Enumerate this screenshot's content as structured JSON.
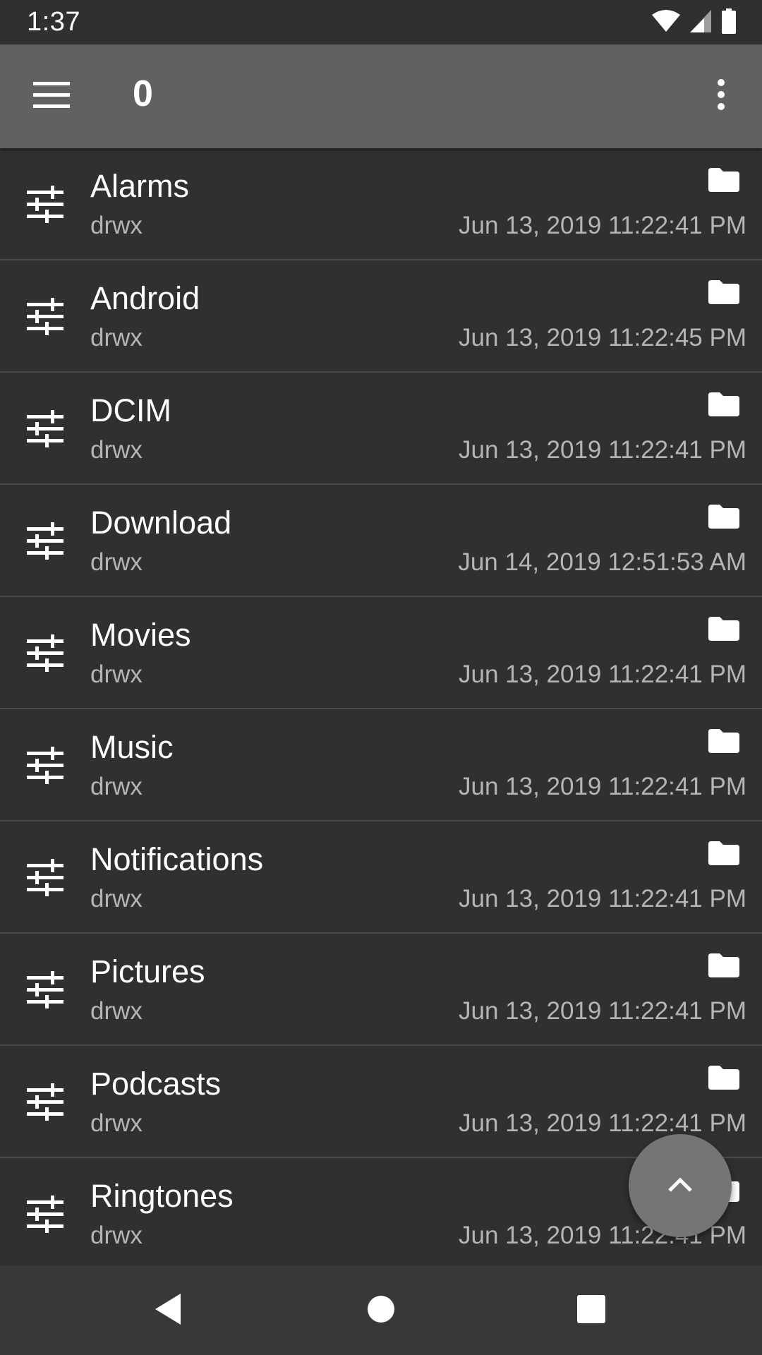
{
  "status_bar": {
    "time": "1:37",
    "icons": [
      "wifi-icon",
      "cell-signal-icon",
      "battery-icon"
    ]
  },
  "app_bar": {
    "title": "0",
    "menu_icon": "hamburger-menu-icon",
    "overflow_icon": "more-vert-icon"
  },
  "files": [
    {
      "name": "Alarms",
      "perm": "drwx",
      "date": "Jun 13, 2019 11:22:41 PM"
    },
    {
      "name": "Android",
      "perm": "drwx",
      "date": "Jun 13, 2019 11:22:45 PM"
    },
    {
      "name": "DCIM",
      "perm": "drwx",
      "date": "Jun 13, 2019 11:22:41 PM"
    },
    {
      "name": "Download",
      "perm": "drwx",
      "date": "Jun 14, 2019 12:51:53 AM"
    },
    {
      "name": "Movies",
      "perm": "drwx",
      "date": "Jun 13, 2019 11:22:41 PM"
    },
    {
      "name": "Music",
      "perm": "drwx",
      "date": "Jun 13, 2019 11:22:41 PM"
    },
    {
      "name": "Notifications",
      "perm": "drwx",
      "date": "Jun 13, 2019 11:22:41 PM"
    },
    {
      "name": "Pictures",
      "perm": "drwx",
      "date": "Jun 13, 2019 11:22:41 PM"
    },
    {
      "name": "Podcasts",
      "perm": "drwx",
      "date": "Jun 13, 2019 11:22:41 PM"
    },
    {
      "name": "Ringtones",
      "perm": "drwx",
      "date": "Jun 13, 2019 11:22:41 PM"
    }
  ],
  "row_icons": {
    "left": "tune-sliders-icon",
    "right": "folder-icon"
  },
  "fab": {
    "icon": "chevron-up-icon"
  },
  "nav_bar": {
    "icons": [
      "back-icon",
      "home-icon",
      "recents-icon"
    ]
  },
  "colors": {
    "background": "#303030",
    "app_bar": "#616161",
    "secondary_text": "#b5b5b5",
    "divider": "#4a4a4a",
    "fab": "#757575",
    "nav_bar": "#383838"
  }
}
